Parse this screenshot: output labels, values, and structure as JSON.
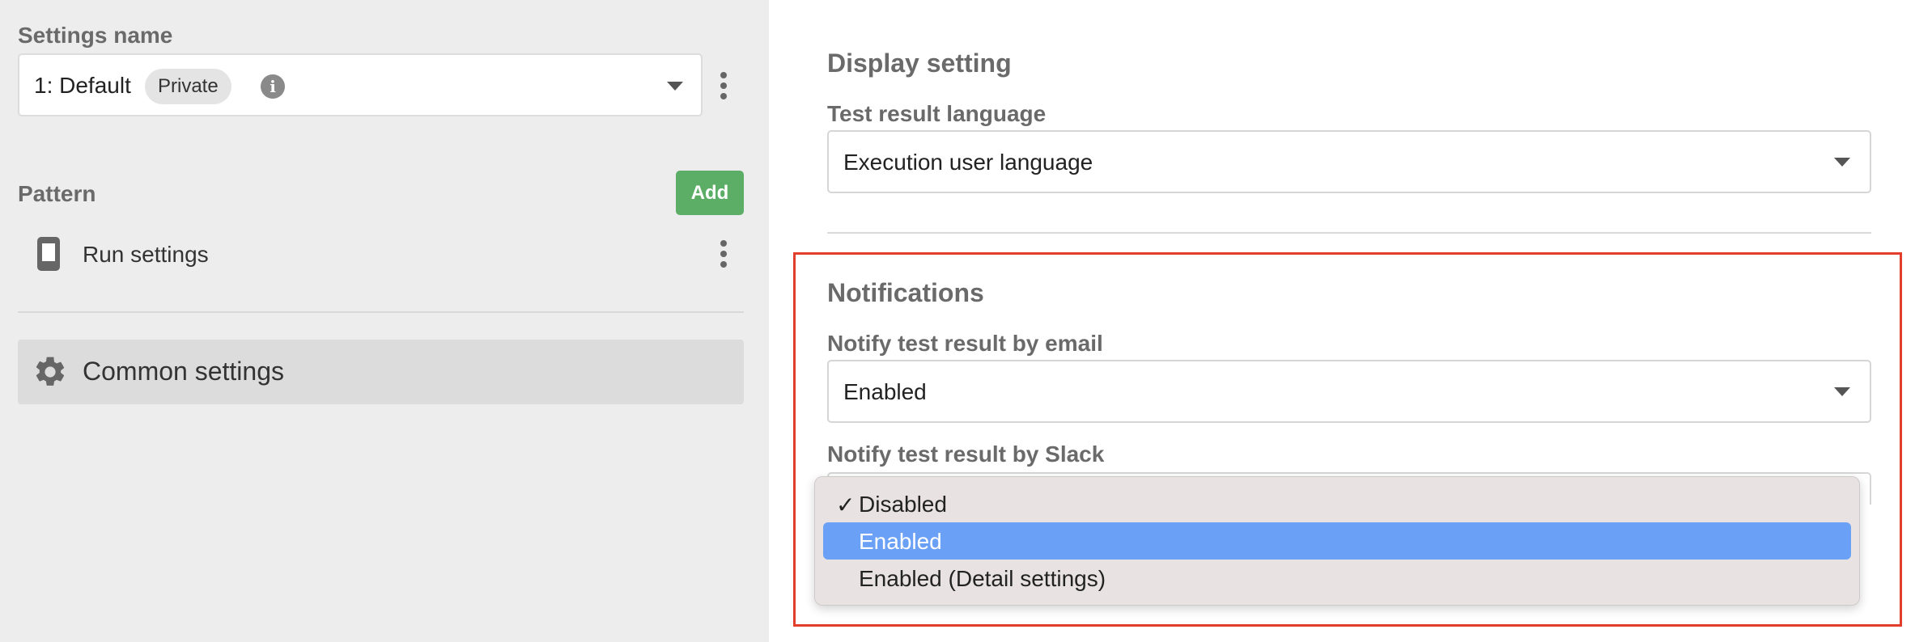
{
  "left": {
    "settings_name_label": "Settings name",
    "settings_select": {
      "value": "1: Default",
      "badge": "Private",
      "info": "i"
    },
    "pattern_label": "Pattern",
    "add_button": "Add",
    "pattern_items": [
      {
        "label": "Run settings",
        "icon": "mobile-phone-icon"
      }
    ],
    "common_settings": {
      "label": "Common settings",
      "icon": "gear-icon"
    }
  },
  "right": {
    "display_title": "Display setting",
    "language_label": "Test result language",
    "language_value": "Execution user language",
    "notifications_title": "Notifications",
    "email_label": "Notify test result by email",
    "email_value": "Enabled",
    "slack_label": "Notify test result by Slack",
    "slack_dropdown": {
      "options": [
        {
          "label": "Disabled",
          "checked": true,
          "highlighted": false
        },
        {
          "label": "Enabled",
          "checked": false,
          "highlighted": true
        },
        {
          "label": "Enabled (Detail settings)",
          "checked": false,
          "highlighted": false
        }
      ],
      "check_glyph": "✓"
    }
  },
  "colors": {
    "add_button": "#5cad65",
    "highlight": "#6aa1f7",
    "callout_border": "#e23e2b",
    "left_panel_bg": "#ededed"
  }
}
